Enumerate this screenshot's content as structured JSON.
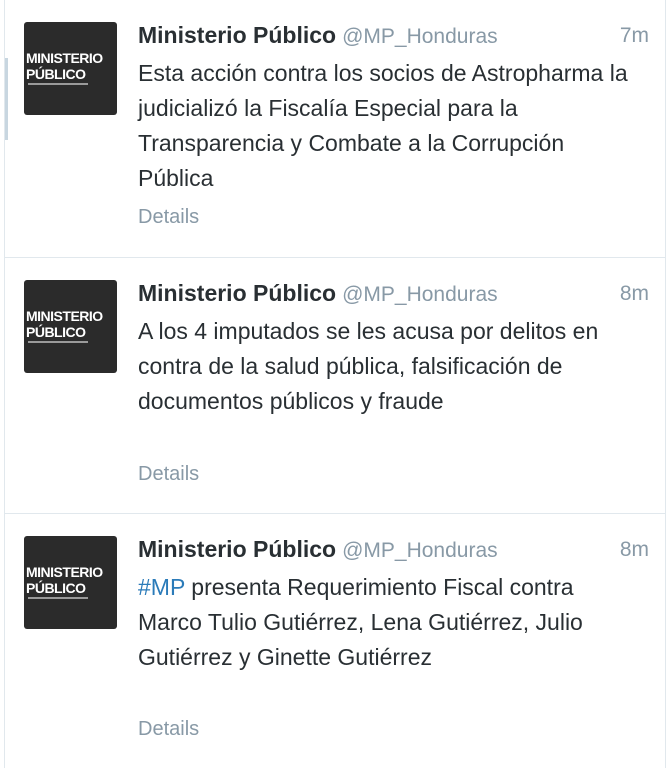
{
  "avatar_logo": {
    "line1": "MINISTERIO",
    "line2": "PÚBLICO"
  },
  "colors": {
    "hashtag": "#2b7bb9",
    "name": "#292f33",
    "meta": "#8899a6",
    "avatar_bg": "#2b2b2b"
  },
  "icons": [
    "ministerio-publico-avatar-icon"
  ],
  "tweets": [
    {
      "name": "Ministerio Público",
      "handle": "@MP_Honduras",
      "time": "7m",
      "text": "Esta acción contra los socios de Astropharma la judicializó la Fiscalía Especial para la Transparencia y Combate a la Corrupción Pública",
      "details": "Details"
    },
    {
      "name": "Ministerio Público",
      "handle": "@MP_Honduras",
      "time": "8m",
      "text": "A los 4 imputados se les acusa por delitos en contra de la salud pública, falsificación de documentos públicos y fraude",
      "details": "Details"
    },
    {
      "name": "Ministerio Público",
      "handle": "@MP_Honduras",
      "time": "8m",
      "hashtag": "#MP",
      "text": " presenta Requerimiento Fiscal contra Marco Tulio Gutiérrez, Lena Gutiérrez, Julio Gutiérrez y Ginette Gutiérrez",
      "details": "Details"
    }
  ]
}
